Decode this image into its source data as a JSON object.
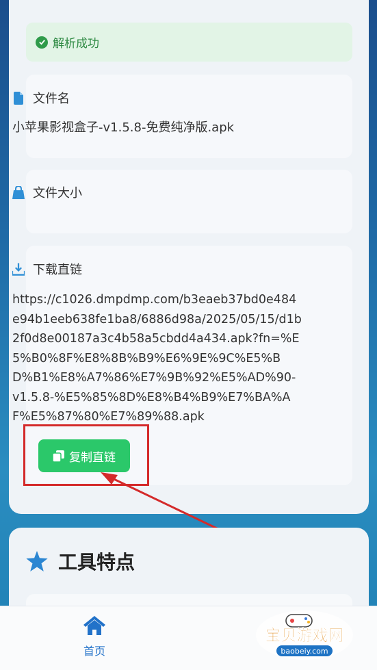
{
  "status": {
    "text": "解析成功"
  },
  "file_name": {
    "label": "文件名",
    "value": "小苹果影视盒子-v1.5.8-免费纯净版.apk"
  },
  "file_size": {
    "label": "文件大小",
    "value": ""
  },
  "download_link": {
    "label": "下载直链",
    "lines": [
      "https://c1026.dmpdmp.com/b3eaeb37bd0e484",
      "e94b1eeb638fe1ba8/6886d98a/2025/05/15/d1b",
      "2f0d8e00187a3c4b58a5cbdd4a434.apk?fn=%E",
      "5%B0%8F%E8%8B%B9%E6%9E%9C%E5%B",
      "D%B1%E8%A7%86%E7%9B%92%E5%AD%90-",
      "v1.5.8-%E5%85%8D%E8%B4%B9%E7%BA%A",
      "F%E5%87%80%E7%89%88.apk"
    ],
    "copy_label": "复制直链"
  },
  "features": {
    "title": "工具特点"
  },
  "nav": {
    "home_label": "首页"
  },
  "watermark": {
    "main": "宝贝游戏网",
    "sub": "baobeiy.com"
  },
  "colors": {
    "primary": "#1e73c4",
    "success": "#2f8a44",
    "copy_button": "#2bc86a",
    "highlight": "#d42a2a"
  },
  "icons": [
    "check-circle-icon",
    "file-icon",
    "bag-icon",
    "download-icon",
    "copy-icon",
    "star-icon",
    "home-icon"
  ]
}
